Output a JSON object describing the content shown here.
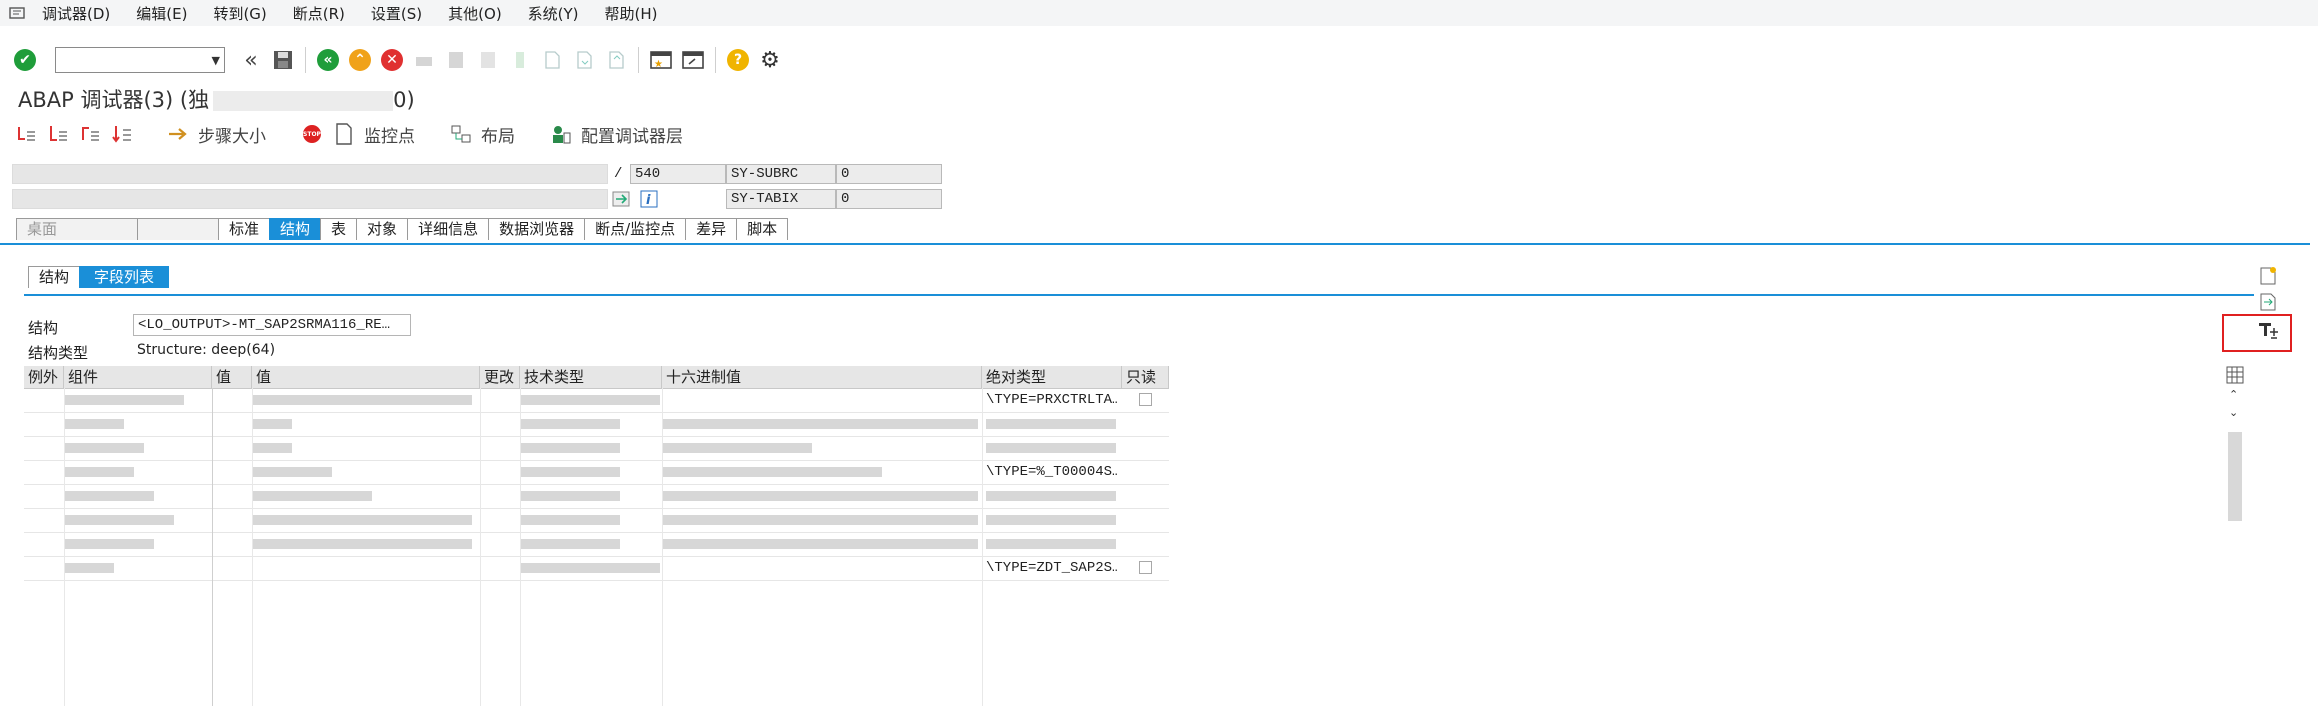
{
  "menubar": {
    "items": [
      "调试器(D)",
      "编辑(E)",
      "转到(G)",
      "断点(R)",
      "设置(S)",
      "其他(O)",
      "系统(Y)",
      "帮助(H)"
    ]
  },
  "toolbar": {
    "command_field_value": "",
    "icons": [
      "check-icon",
      "save-icon",
      "back-icon",
      "exit-icon",
      "cancel-icon",
      "new-session-icon",
      "help-icon",
      "settings-icon"
    ]
  },
  "title": {
    "text": "ABAP 调试器(3) (独"
  },
  "apptoolbar": {
    "step_size_label": "步骤大小",
    "watchpoint_label": "监控点",
    "layout_label": "布局",
    "configure_label": "配置调试器层"
  },
  "info": {
    "line_number": "540",
    "sy_subrc_label": "SY-SUBRC",
    "sy_subrc_value": "0",
    "sy_tabix_label": "SY-TABIX",
    "sy_tabix_value": "0"
  },
  "main_tabs": [
    "桌面",
    "标准",
    "结构",
    "表",
    "对象",
    "详细信息",
    "数据浏览器",
    "断点/监控点",
    "差异",
    "脚本"
  ],
  "sub_tabs": [
    "结构",
    "字段列表"
  ],
  "structure": {
    "label": "结构",
    "value": "<LO_OUTPUT>-MT_SAP2SRMA116_RE…",
    "type_label": "结构类型",
    "type_value": "Structure: deep(64)"
  },
  "table": {
    "columns": [
      "例外",
      "组件",
      "值",
      "值",
      "更改",
      "技术类型",
      "十六进制值",
      "绝对类型",
      "只读"
    ],
    "rows": [
      {
        "abs_type": "\\TYPE=PRXCTRLTA…"
      },
      {
        "abs_type": ""
      },
      {
        "abs_type": ""
      },
      {
        "abs_type": "\\TYPE=%_T00004S…"
      },
      {
        "abs_type": ""
      },
      {
        "abs_type": ""
      },
      {
        "abs_type": ""
      },
      {
        "abs_type": "\\TYPE=ZDT_SAP2S…"
      }
    ]
  },
  "colors": {
    "accent": "#1a8fd8",
    "highlight": "#e02020"
  }
}
